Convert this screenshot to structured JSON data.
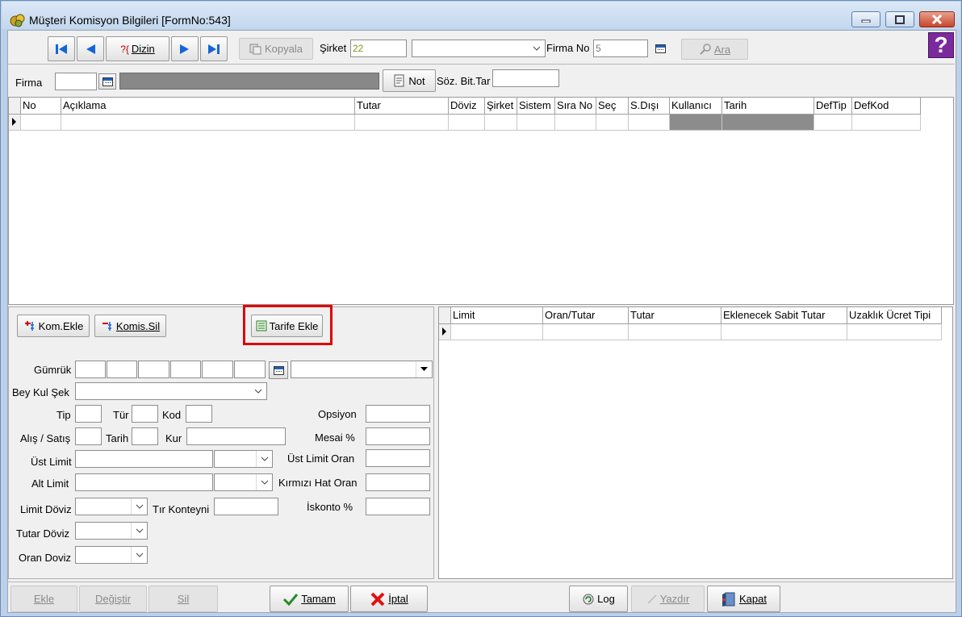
{
  "window": {
    "title": "Müşteri Komisyon Bilgileri [FormNo:543]"
  },
  "toolbar": {
    "dizin_label": "Dizin",
    "kopyala_label": "Kopyala",
    "sirket_label": "Şirket",
    "sirket_value": "22",
    "firma_no_label": "Firma No",
    "firma_no_value": "5",
    "ara_label": "Ara"
  },
  "firma_row": {
    "firma_label": "Firma",
    "not_label": "Not",
    "soz_bit_tar_label": "Söz. Bit.Tar"
  },
  "main_grid": {
    "columns": [
      "No",
      "Açıklama",
      "Tutar",
      "Döviz",
      "Şirket",
      "Sistem",
      "Sıra No",
      "Seç",
      "S.Dışı",
      "Kullanıcı",
      "Tarih",
      "DefTip",
      "DefKod"
    ]
  },
  "left_panel": {
    "kom_ekle_label": "Kom.Ekle",
    "komis_sil_label": "Komis.Sil",
    "tarife_ekle_label": "Tarife Ekle",
    "gumruk_label": "Gümrük",
    "bey_kul_sek_label": "Bey Kul Şek",
    "tip_label": "Tip",
    "tur_label": "Tür",
    "kod_label": "Kod",
    "alis_satis_label": "Alış / Satış",
    "tarih_label": "Tarih",
    "kur_label": "Kur",
    "ust_limit_label": "Üst Limit",
    "alt_limit_label": "Alt Limit",
    "limit_doviz_label": "Limit Döviz",
    "tir_konteyni_label": "Tır Konteyni",
    "tutar_doviz_label": "Tutar Döviz",
    "oran_doviz_label": "Oran Doviz",
    "opsiyon_label": "Opsiyon",
    "mesai_label": "Mesai %",
    "ust_limit_oran_label": "Üst Limit Oran",
    "kirmizi_hat_oran_label": "Kırmızı Hat Oran",
    "iskonto_label": "İskonto %"
  },
  "right_grid": {
    "columns": [
      "Limit",
      "Oran/Tutar",
      "Tutar",
      "Eklenecek Sabit Tutar",
      "Uzaklık Ücret Tipi"
    ]
  },
  "bottom": {
    "ekle_label": "Ekle",
    "degistir_label": "Değiştir",
    "sil_label": "Sil",
    "tamam_label": "Tamam",
    "iptal_label": "İptal",
    "log_label": "Log",
    "yazdir_label": "Yazdır",
    "kapat_label": "Kapat"
  },
  "colors": {
    "highlight": "#e00000",
    "nav_arrow": "#1565d8",
    "disabled_text": "#8a8a8a"
  }
}
